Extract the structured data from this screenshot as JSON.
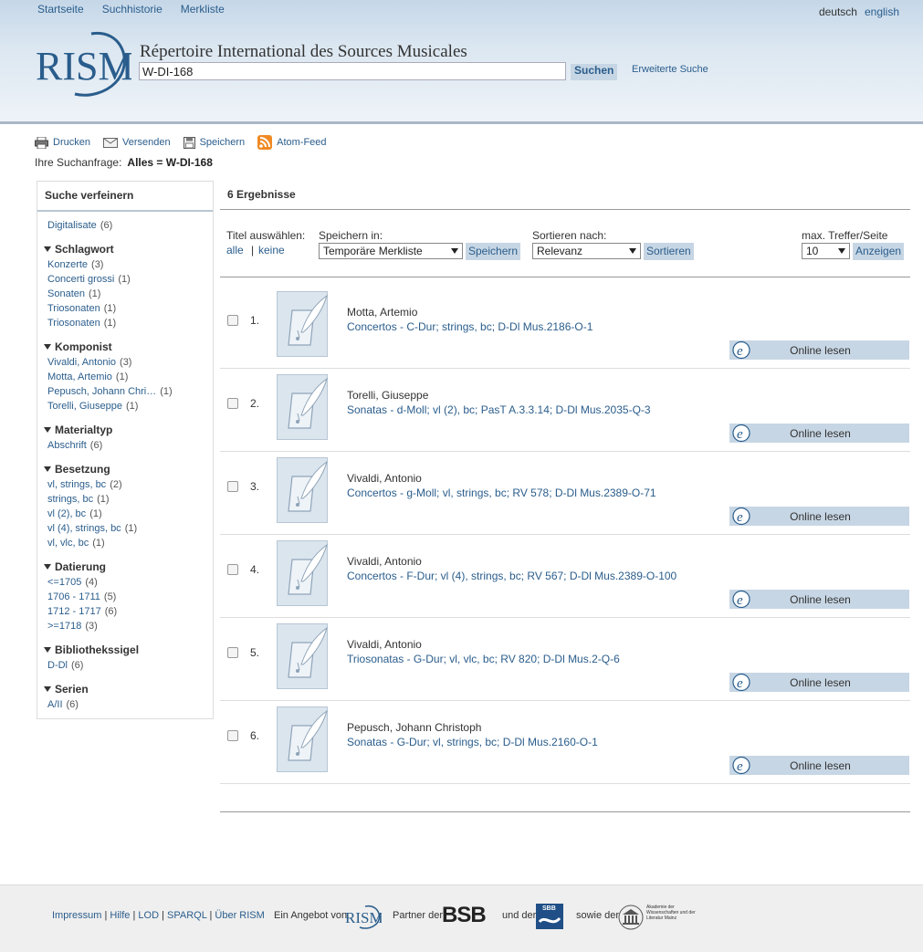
{
  "header": {
    "nav": [
      "Startseite",
      "Suchhistorie",
      "Merkliste"
    ],
    "lang": [
      "deutsch",
      "english"
    ],
    "logo_text": "RISM",
    "site_title": "Répertoire International des Sources Musicales",
    "search_value": "W-DI-168",
    "search_button": "Suchen",
    "advanced_search": "Erweiterte Suche"
  },
  "toolbar": {
    "print": "Drucken",
    "send": "Versenden",
    "save": "Speichern",
    "feed": "Atom-Feed",
    "query_label": "Ihre Suchanfrage:",
    "query_value": "Alles = W-DI-168"
  },
  "sidebar": {
    "title": "Suche verfeinern",
    "digitalisate": {
      "label": "Digitalisate",
      "count": "(6)"
    },
    "groups": [
      {
        "heading": "Schlagwort",
        "items": [
          {
            "label": "Konzerte",
            "count": "(3)"
          },
          {
            "label": "Concerti grossi",
            "count": "(1)"
          },
          {
            "label": "Sonaten",
            "count": "(1)"
          },
          {
            "label": "Triosonaten",
            "count": "(1)"
          },
          {
            "label": "Triosonaten",
            "count": "(1)"
          }
        ]
      },
      {
        "heading": "Komponist",
        "items": [
          {
            "label": "Vivaldi, Antonio",
            "count": "(3)"
          },
          {
            "label": "Motta, Artemio",
            "count": "(1)"
          },
          {
            "label": "Pepusch, Johann Chri…",
            "count": "(1)"
          },
          {
            "label": "Torelli, Giuseppe",
            "count": "(1)"
          }
        ]
      },
      {
        "heading": "Materialtyp",
        "items": [
          {
            "label": "Abschrift",
            "count": "(6)"
          }
        ]
      },
      {
        "heading": "Besetzung",
        "items": [
          {
            "label": "vl, strings, bc",
            "count": "(2)"
          },
          {
            "label": "strings, bc",
            "count": "(1)"
          },
          {
            "label": "vl (2), bc",
            "count": "(1)"
          },
          {
            "label": "vl (4), strings, bc",
            "count": "(1)"
          },
          {
            "label": "vl, vlc, bc",
            "count": "(1)"
          }
        ]
      },
      {
        "heading": "Datierung",
        "items": [
          {
            "label": "<=1705",
            "count": "(4)"
          },
          {
            "label": "1706 - 1711",
            "count": "(5)"
          },
          {
            "label": "1712 - 1717",
            "count": "(6)"
          },
          {
            "label": ">=1718",
            "count": "(3)"
          }
        ]
      },
      {
        "heading": "Bibliothekssigel",
        "items": [
          {
            "label": "D-Dl",
            "count": "(6)"
          }
        ]
      },
      {
        "heading": "Serien",
        "items": [
          {
            "label": "A/II",
            "count": "(6)"
          }
        ]
      }
    ]
  },
  "results": {
    "count_text": "6 Ergebnisse",
    "title_select_label": "Titel auswählen:",
    "all": "alle",
    "separator": "|",
    "none": "keine",
    "save_in_label": "Speichern in:",
    "save_in_value": "Temporäre Merkliste",
    "save_button": "Speichern",
    "sort_label": "Sortieren nach:",
    "sort_value": "Relevanz",
    "sort_button": "Sortieren",
    "max_label": "max. Treffer/Seite",
    "max_value": "10",
    "show_button": "Anzeigen",
    "online_label": "Online lesen",
    "items": [
      {
        "num": "1.",
        "author": "Motta, Artemio",
        "title": "Concertos - C-Dur; strings, bc; D-Dl Mus.2186-O-1"
      },
      {
        "num": "2.",
        "author": "Torelli, Giuseppe",
        "title": "Sonatas - d-Moll; vl (2), bc; PasT A.3.3.14; D-Dl Mus.2035-Q-3"
      },
      {
        "num": "3.",
        "author": "Vivaldi, Antonio",
        "title": "Concertos - g-Moll; vl, strings, bc; RV 578; D-Dl Mus.2389-O-71"
      },
      {
        "num": "4.",
        "author": "Vivaldi, Antonio",
        "title": "Concertos - F-Dur; vl (4), strings, bc; RV 567; D-Dl Mus.2389-O-100"
      },
      {
        "num": "5.",
        "author": "Vivaldi, Antonio",
        "title": "Triosonatas - G-Dur; vl, vlc, bc; RV 820; D-Dl Mus.2-Q-6"
      },
      {
        "num": "6.",
        "author": "Pepusch, Johann Christoph",
        "title": "Sonatas - G-Dur; vl, strings, bc; D-Dl Mus.2160-O-1"
      }
    ]
  },
  "footer": {
    "links": [
      "Impressum",
      "Hilfe",
      "LOD",
      "SPARQL",
      "Über RISM"
    ],
    "offer_text": "Ein Angebot von",
    "partner_text": "Partner der",
    "and_text": "und der",
    "also_text": "sowie der",
    "bsb_logo": "BSB",
    "sbb_logo": "SBB",
    "academy_logo": "Akademie der Wissenschaften und der Literatur Mainz"
  },
  "colors": {
    "link": "#2a5d8c",
    "button_bg": "#c7d6e4",
    "header_bg": "#dce7f1"
  }
}
